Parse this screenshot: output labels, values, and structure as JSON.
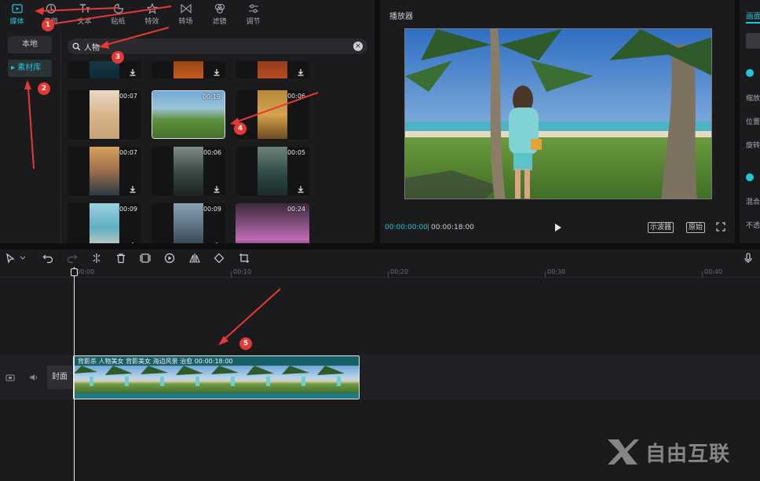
{
  "toolbar": {
    "tabs": [
      {
        "label": "媒体",
        "icon": "media-icon",
        "active": true
      },
      {
        "label": "音频",
        "icon": "audio-icon",
        "active": false
      },
      {
        "label": "文本",
        "icon": "text-icon",
        "active": false
      },
      {
        "label": "贴纸",
        "icon": "sticker-icon",
        "active": false
      },
      {
        "label": "特效",
        "icon": "effects-icon",
        "active": false
      },
      {
        "label": "转场",
        "icon": "transition-icon",
        "active": false
      },
      {
        "label": "滤镜",
        "icon": "filter-icon",
        "active": false
      },
      {
        "label": "调节",
        "icon": "adjust-icon",
        "active": false
      }
    ]
  },
  "sidebar": {
    "items": [
      {
        "label": "本地",
        "active": false
      },
      {
        "label": "素材库",
        "active": true
      }
    ]
  },
  "search": {
    "value": "人物",
    "icon": "search-icon"
  },
  "library": {
    "items": [
      {
        "duration": "",
        "download": true
      },
      {
        "duration": "",
        "download": true
      },
      {
        "duration": "",
        "download": true
      },
      {
        "duration": "00:07",
        "download": false
      },
      {
        "duration": "00:19",
        "download": false
      },
      {
        "duration": "00:06",
        "download": false
      },
      {
        "duration": "00:07",
        "download": true
      },
      {
        "duration": "00:06",
        "download": true
      },
      {
        "duration": "00:05",
        "download": true
      },
      {
        "duration": "00:09",
        "download": true
      },
      {
        "duration": "00:09",
        "download": true
      },
      {
        "duration": "00:24",
        "download": false
      }
    ]
  },
  "player": {
    "title": "播放器",
    "current_time": "00:00:00:00",
    "separator": "|",
    "total_time": "00:00:18:00",
    "scope_label": "示波器",
    "original_label": "原始"
  },
  "props": {
    "tab": "画面",
    "labels": [
      "缩放",
      "位置",
      "旋转",
      "混合",
      "不透"
    ]
  },
  "timeline": {
    "ruler": [
      "00:00",
      "00:10",
      "00:20",
      "00:30",
      "00:40"
    ],
    "cover_label": "封面",
    "clip_label": "背影杀  人物美女  背影美女  海边风景  治愈     00:00:18:00"
  },
  "annotations": [
    "1",
    "2",
    "3",
    "4",
    "5"
  ],
  "watermark": {
    "text": "自由互联"
  },
  "colors": {
    "accent": "#22c4d8",
    "annotation": "#e53935",
    "clip": "#195f66"
  }
}
